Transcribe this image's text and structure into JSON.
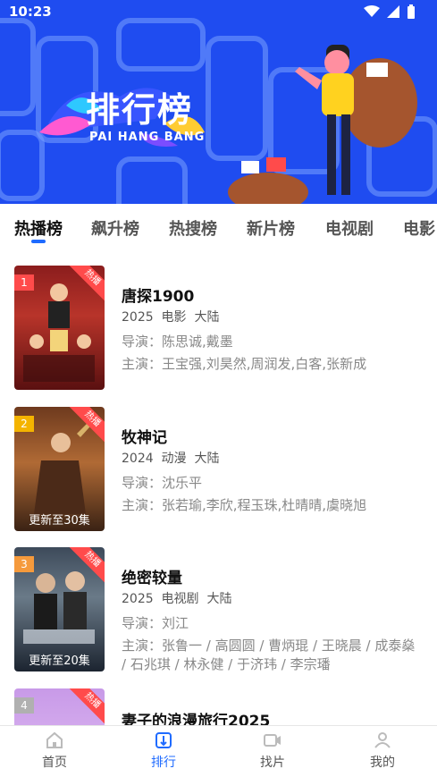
{
  "status": {
    "time": "10:23"
  },
  "banner": {
    "title": "排行榜",
    "subtitle": "PAI HANG BANG"
  },
  "tabs": [
    {
      "label": "热播榜",
      "active": true
    },
    {
      "label": "飙升榜"
    },
    {
      "label": "热搜榜"
    },
    {
      "label": "新片榜"
    },
    {
      "label": "电视剧"
    },
    {
      "label": "电影"
    }
  ],
  "items": [
    {
      "rank": "1",
      "hot": "热播",
      "title": "唐探1900",
      "year": "2025",
      "type": "电影",
      "region": "大陆",
      "director": "导演：陈思诚,戴墨",
      "cast": "主演：王宝强,刘昊然,周润发,白客,张新成",
      "update": "",
      "rank_color": "#ff4b4b"
    },
    {
      "rank": "2",
      "hot": "热播",
      "title": "牧神记",
      "year": "2024",
      "type": "动漫",
      "region": "大陆",
      "director": "导演：沈乐平",
      "cast": "主演：张若瑜,李欣,程玉珠,杜晴晴,虞晓旭",
      "update": "更新至30集",
      "rank_color": "#f4b400"
    },
    {
      "rank": "3",
      "hot": "热播",
      "title": "绝密较量",
      "year": "2025",
      "type": "电视剧",
      "region": "大陆",
      "director": "导演：刘江",
      "cast": "主演：张鲁一 / 高圆圆 / 曹炳琨 / 王晓晨 / 成泰燊 / 石兆琪 / 林永健 / 于济玮 / 李宗璠",
      "update": "更新至20集",
      "rank_color": "#f59a3c"
    },
    {
      "rank": "4",
      "hot": "热播",
      "title": "妻子的浪漫旅行2025",
      "year": "",
      "type": "",
      "region": "",
      "director": "",
      "cast": "",
      "update": "",
      "rank_color": "#b0b0b0"
    }
  ],
  "nav": [
    {
      "label": "首页",
      "icon": "home-icon"
    },
    {
      "label": "排行",
      "icon": "ranking-icon",
      "active": true
    },
    {
      "label": "找片",
      "icon": "video-icon"
    },
    {
      "label": "我的",
      "icon": "profile-icon"
    }
  ],
  "colors": {
    "accent": "#1f6bff",
    "banner_bg": "#1f4cf0",
    "hot_badge": "#ff4b4b"
  }
}
